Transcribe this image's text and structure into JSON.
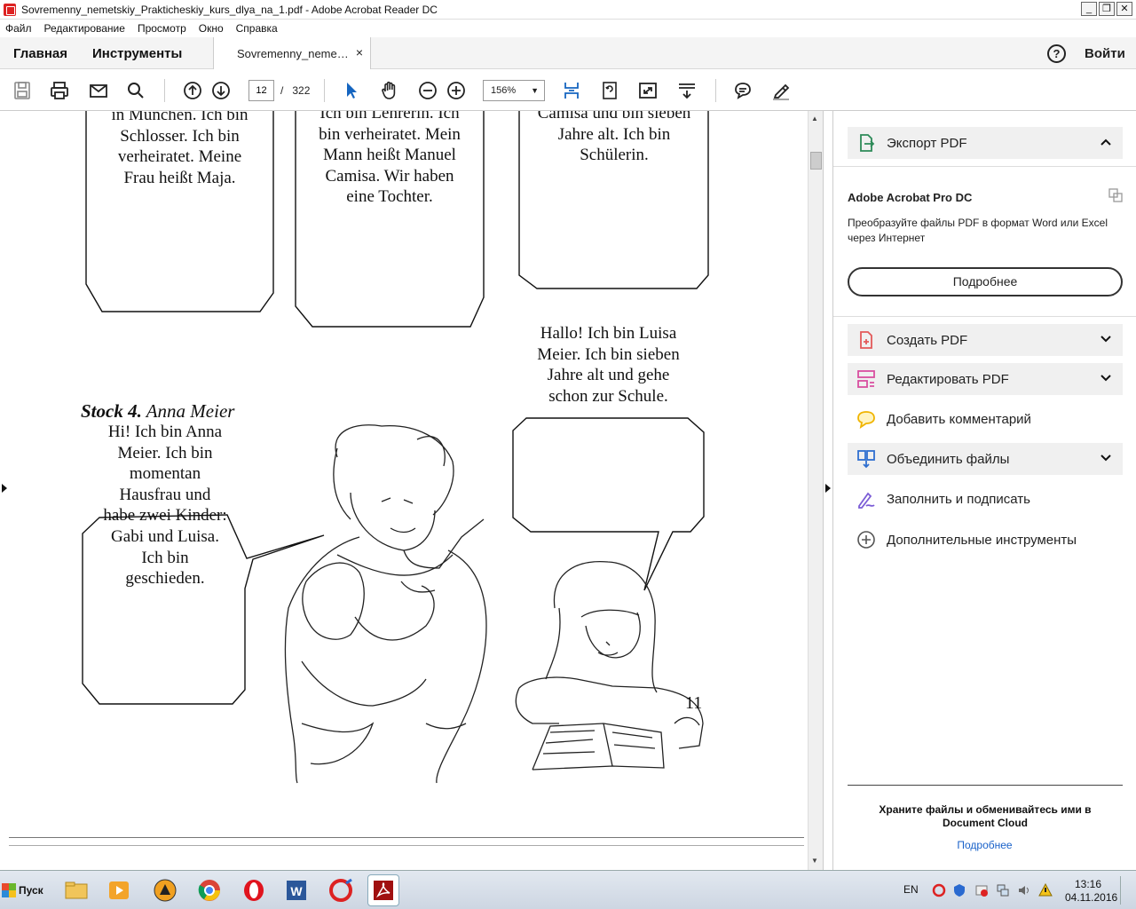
{
  "window": {
    "title": "Sovremenny_nemetskiy_Prakticheskiy_kurs_dlya_na_1.pdf - Adobe Acrobat Reader DC",
    "minimize_label": "_",
    "restore_label": "❐",
    "close_label": "✕"
  },
  "menu": [
    "Файл",
    "Редактирование",
    "Просмотр",
    "Окно",
    "Справка"
  ],
  "nav": {
    "home_label": "Главная",
    "tools_label": "Инструменты",
    "doc_tab_label": "Sovremenny_neme…",
    "doc_tab_close": "×",
    "help_label": "?",
    "signin_label": "Войти"
  },
  "toolbar": {
    "current_page": "12",
    "page_separator": "/",
    "total_pages": "322",
    "zoom": "156%"
  },
  "document": {
    "top_bubbles": [
      [
        "in München. Ich bin",
        "Schlosser. Ich bin",
        "verheiratet. Meine",
        "Frau heißt Maja."
      ],
      [
        "Ich bin Lehrerin. Ich",
        "bin verheiratet. Mein",
        "Mann heißt Manuel",
        "Camisa. Wir haben",
        "eine Tochter."
      ],
      [
        "Camisa und bin sieben",
        "Jahre alt. Ich bin",
        "Schülerin."
      ]
    ],
    "stock_bold": "Stock 4.",
    "stock_name": "Anna Meier",
    "anna_bubble": [
      "Hi! Ich bin Anna",
      "Meier. Ich bin",
      "momentan",
      "Hausfrau und",
      "habe zwei Kinder:",
      "Gabi und Luisa.",
      "Ich bin",
      "geschieden."
    ],
    "luisa_bubble": [
      "Hallo! Ich bin Luisa",
      "Meier. Ich bin sieben",
      "Jahre alt und gehe",
      "schon zur Schule."
    ],
    "page_number": "11"
  },
  "right_panel": {
    "export": {
      "label": "Экспорт PDF",
      "accent": "#2d8a58"
    },
    "promo": {
      "title": "Adobe Acrobat Pro DC",
      "description": "Преобразуйте файлы PDF в формат Word или Excel через Интернет",
      "button": "Подробнее"
    },
    "tools": [
      {
        "label": "Создать PDF",
        "icon": "create-pdf-icon",
        "color": "#e35a5a",
        "expandable": true
      },
      {
        "label": "Редактировать PDF",
        "icon": "edit-pdf-icon",
        "color": "#d94fa0",
        "expandable": true
      },
      {
        "label": "Добавить комментарий",
        "icon": "comment-icon",
        "color": "#f0b400",
        "expandable": false
      },
      {
        "label": "Объединить файлы",
        "icon": "combine-files-icon",
        "color": "#2f6fd0",
        "expandable": true
      },
      {
        "label": "Заполнить и подписать",
        "icon": "fill-sign-icon",
        "color": "#7b5cd6",
        "expandable": false
      },
      {
        "label": "Дополнительные инструменты",
        "icon": "more-tools-icon",
        "color": "#555555",
        "expandable": false
      }
    ],
    "cloud_text": "Храните файлы и обменивайтесь ими в Document Cloud",
    "cloud_link": "Подробнее"
  },
  "taskbar": {
    "start_label": "Пуск",
    "language": "EN",
    "time": "13:16",
    "date": "04.11.2016"
  }
}
